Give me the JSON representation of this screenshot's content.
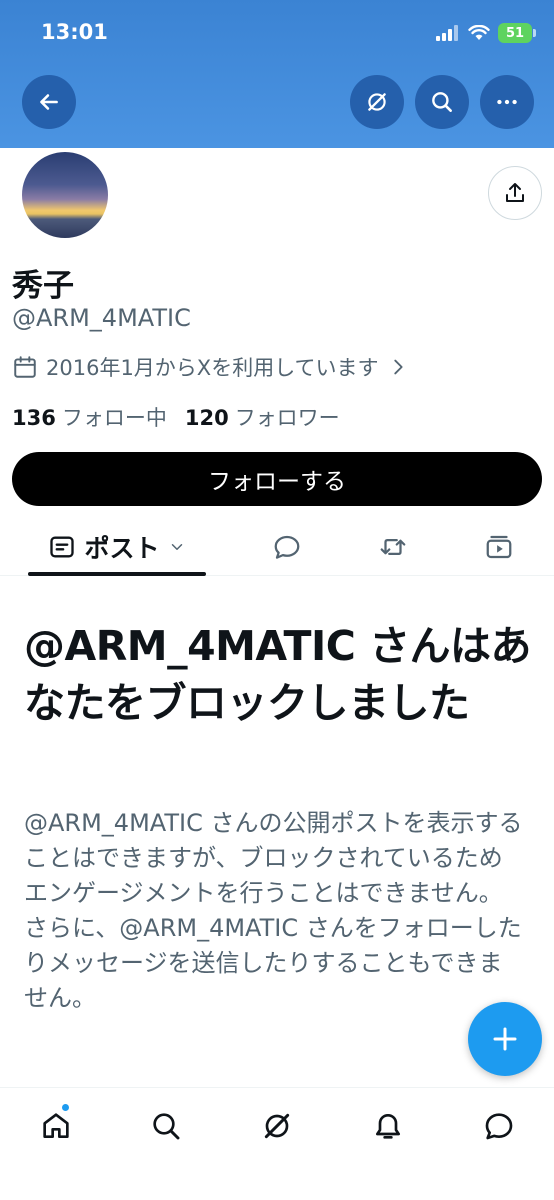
{
  "status_bar": {
    "time": "13:01",
    "battery": "51"
  },
  "profile": {
    "display_name": "秀子",
    "handle": "@ARM_4MATIC",
    "joined": "2016年1月からXを利用しています",
    "following_count": "136",
    "following_label": "フォロー中",
    "followers_count": "120",
    "followers_label": "フォロワー"
  },
  "follow_button": {
    "label": "フォローする"
  },
  "tabs": {
    "posts_label": "ポスト"
  },
  "blocked": {
    "title": "@ARM_4MATIC さんはあなたをブロックしました",
    "description": "@ARM_4MATIC さんの公開ポストを表示することはできますが、ブロックされているためエンゲージメントを行うことはできません。さらに、@ARM_4MATIC さんをフォローしたりメッセージを送信したりすることもできません。"
  },
  "icons": {
    "header": [
      "back-arrow-icon",
      "grok-icon",
      "search-icon",
      "more-icon"
    ],
    "tabs": [
      "posts-icon",
      "chevron-down-icon",
      "reply-icon",
      "repost-icon",
      "media-icon"
    ],
    "bottom_nav": [
      "home-icon",
      "search-icon",
      "grok-icon",
      "notifications-icon",
      "messages-icon"
    ],
    "other": [
      "share-icon",
      "calendar-icon",
      "chevron-right-icon",
      "compose-plus-icon"
    ]
  },
  "colors": {
    "accent": "#1d9bf0",
    "banner": "#4b94e2",
    "secondary_text": "#536471"
  }
}
